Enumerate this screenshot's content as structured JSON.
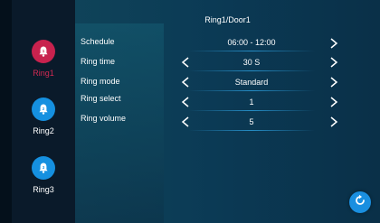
{
  "header": {
    "title": "Ring1/Door1"
  },
  "sidebar": {
    "items": [
      {
        "label": "Ring1",
        "active": true
      },
      {
        "label": "Ring2",
        "active": false
      },
      {
        "label": "Ring3",
        "active": false
      }
    ]
  },
  "settings": {
    "schedule": {
      "label": "Schedule",
      "value": "06:00 - 12:00"
    },
    "ring_time": {
      "label": "Ring time",
      "value": "30 S"
    },
    "ring_mode": {
      "label": "Ring mode",
      "value": "Standard"
    },
    "ring_select": {
      "label": "Ring select",
      "value": "1"
    },
    "ring_volume": {
      "label": "Ring volume",
      "value": "5"
    }
  },
  "colors": {
    "active": "#c8224e",
    "accent": "#1590e0"
  },
  "icons": {
    "ring": "bell-icon",
    "prev": "chevron-left-icon",
    "next": "chevron-right-icon",
    "refresh": "refresh-icon"
  }
}
